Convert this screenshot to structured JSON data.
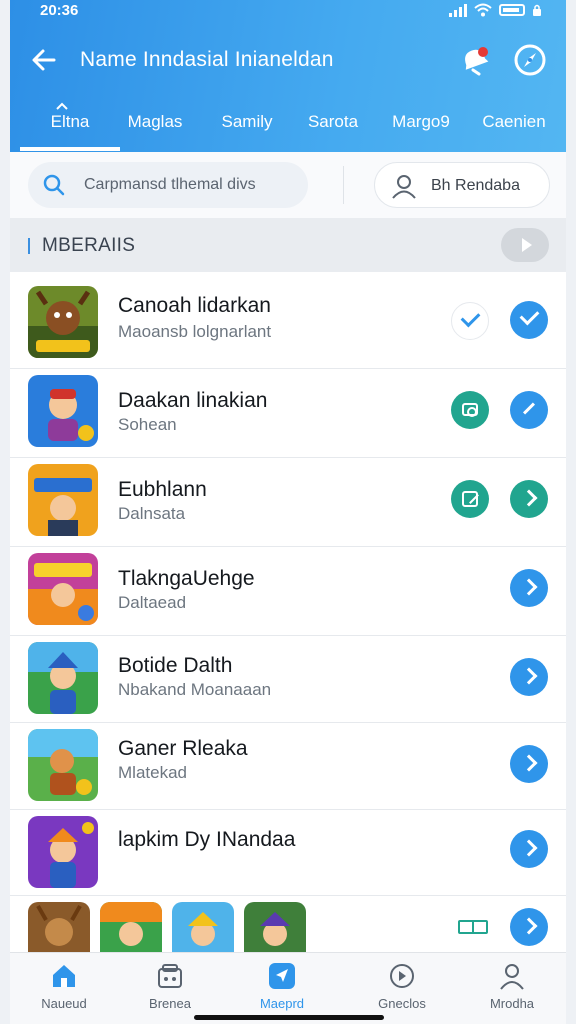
{
  "status": {
    "time": "20:36"
  },
  "header": {
    "title": "Name Inndasial Inianeldan",
    "tabs": [
      {
        "label": "Eltna",
        "active": true
      },
      {
        "label": "Maglas",
        "active": false
      },
      {
        "label": "Samily",
        "active": false
      },
      {
        "label": "Sarota",
        "active": false
      },
      {
        "label": "Margo9",
        "active": false
      },
      {
        "label": "Caenien",
        "active": false
      }
    ]
  },
  "search": {
    "placeholder": "Carpmansd tlhemal divs",
    "user_label": "Bh Rendaba"
  },
  "section": {
    "title": "MBERAIIS"
  },
  "list": [
    {
      "title": "Canoah lidarkan",
      "subtitle": "Maoansb lolgnarlant",
      "action": "check",
      "button": "check"
    },
    {
      "title": "Daakan linakian",
      "subtitle": "Sohean",
      "action": "camera",
      "button": "edit"
    },
    {
      "title": "Eubhlann",
      "subtitle": "Dalnsata",
      "action": "edit",
      "button": "arrow-teal"
    },
    {
      "title": "TlakngaUehge",
      "subtitle": "Daltaead",
      "action": "",
      "button": "arrow"
    },
    {
      "title": "Botide Dalth",
      "subtitle": "Nbakand Moanaaan",
      "action": "",
      "button": "arrow"
    },
    {
      "title": "Ganer Rleaka",
      "subtitle": "Mlatekad",
      "action": "",
      "button": "arrow"
    },
    {
      "title": "lapkim Dy INandaa",
      "subtitle": "",
      "action": "",
      "button": "arrow"
    }
  ],
  "nav": [
    {
      "label": "Naueud",
      "icon": "home-icon",
      "active": false
    },
    {
      "label": "Brenea",
      "icon": "store-icon",
      "active": false
    },
    {
      "label": "Maeprd",
      "icon": "navigate-icon",
      "active": true
    },
    {
      "label": "Gneclos",
      "icon": "explore-icon",
      "active": false
    },
    {
      "label": "Mrodha",
      "icon": "profile-icon",
      "active": false
    }
  ],
  "colors": {
    "primary": "#2f95ea",
    "teal": "#21a58f",
    "header_start": "#2d8fe6",
    "header_end": "#53b6f2"
  }
}
